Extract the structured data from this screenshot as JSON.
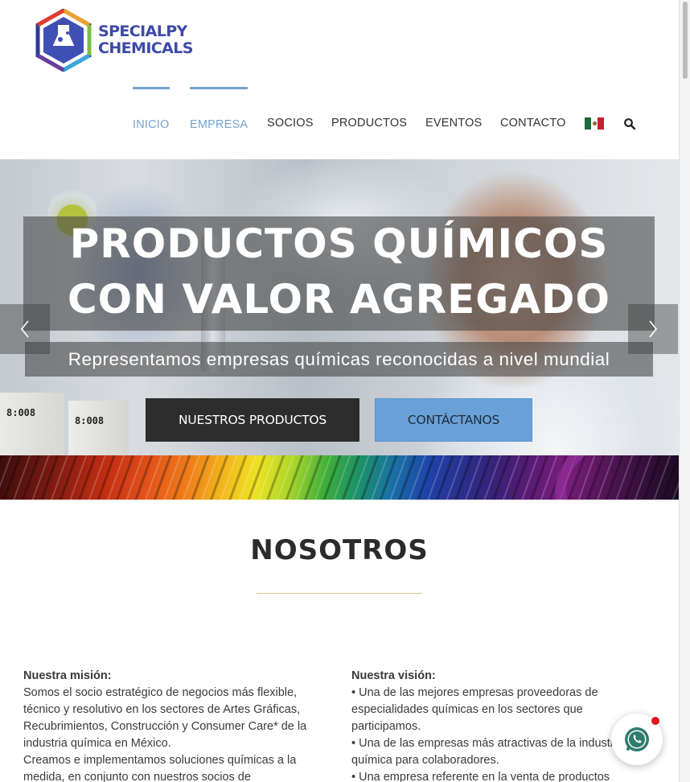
{
  "brand": {
    "name_line1": "SPECIALPY",
    "name_line2": "CHEMICALS",
    "colors": {
      "primary": "#3d4aa6",
      "accent": "#73a4cf",
      "dark_button": "#2d2d2d",
      "light_button": "#6aa1d6"
    }
  },
  "nav": {
    "items": [
      {
        "label": "INICIO",
        "active": true
      },
      {
        "label": "EMPRESA",
        "active": true
      },
      {
        "label": "SOCIOS",
        "active": false
      },
      {
        "label": "PRODUCTOS",
        "active": false
      },
      {
        "label": "EVENTOS",
        "active": false
      },
      {
        "label": "CONTACTO",
        "active": false
      }
    ],
    "language_icon": "mexico-flag-icon",
    "search_icon": "search-icon"
  },
  "hero": {
    "title_line1": "PRODUCTOS QUÍMICOS",
    "title_line2": "CON VALOR AGREGADO",
    "subtitle": "Representamos empresas químicas reconocidas a nivel mundial",
    "primary_button": "NUESTROS PRODUCTOS",
    "secondary_button": "CONTÁCTANOS",
    "bottle_labels": [
      "8:008",
      "8:008"
    ],
    "prev_icon": "chevron-left-icon",
    "next_icon": "chevron-right-icon"
  },
  "about": {
    "title": "NOSOTROS",
    "mission": {
      "heading": "Nuestra misión:",
      "paragraphs": [
        "Somos el socio estratégico de negocios más flexible, técnico y resolutivo en los sectores de Artes Gráficas, Recubrimientos, Construcción y Consumer Care* de la industria química en México.",
        "Creamos e implementamos soluciones químicas a la medida, en conjunto con nuestros socios de"
      ]
    },
    "vision": {
      "heading": "Nuestra visión:",
      "items": [
        "• Una de las mejores empresas proveedoras de especialidades químicas en los sectores que participamos.",
        "• Una de las empresas más atractivas de la industria química para colaboradores.",
        "• Una empresa referente en la venta de productos"
      ]
    }
  },
  "whatsapp": {
    "icon": "whatsapp-icon",
    "badge_color": "#e0181b"
  }
}
